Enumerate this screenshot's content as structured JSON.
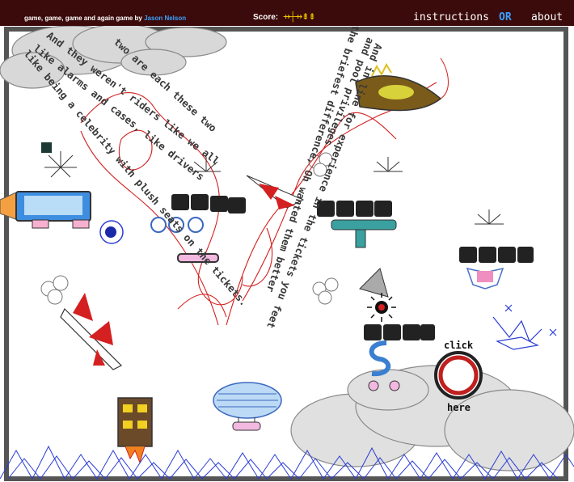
{
  "header": {
    "title": "game, game, game and again game",
    "by": "by",
    "author": "Jason Nelson",
    "score_label": "Score:",
    "score_glyphs": "⇸┼⇸⇟⇟",
    "instructions_label": "instructions",
    "or_label": "OR",
    "about_label": "about"
  },
  "poem_lines": [
    "And they weren't riders like we all",
    "like alarms and cases, like drivers",
    "like being a celebrity with plush seats on the tickets.",
    "two are each these two",
    "And in line for experience in the tickets you feet",
    "the briefest difference, Oh wanted them better",
    "and pool privileges"
  ],
  "click_button": {
    "top_label": "click",
    "bottom_label": "here"
  },
  "colors": {
    "topbar": "#3b0a0a",
    "author_link": "#3aa0ff",
    "score": "#ffd400",
    "scribble_red": "#d42020",
    "mountain_blue": "#2b3cd6"
  }
}
